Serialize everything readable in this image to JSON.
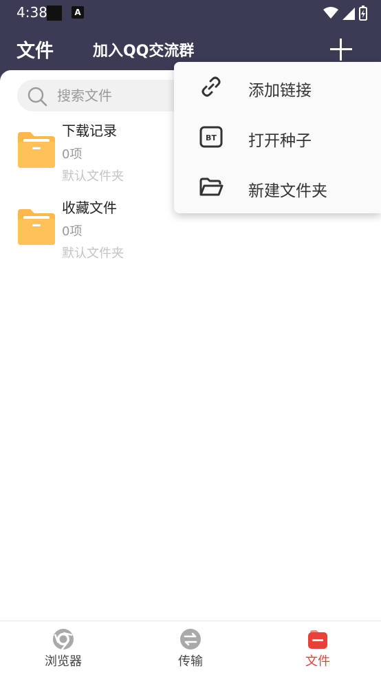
{
  "status": {
    "time": "4:38",
    "notif_letter": "A"
  },
  "header": {
    "title": "文件",
    "join_group": "加入QQ交流群"
  },
  "search": {
    "placeholder": "搜索文件"
  },
  "folders": [
    {
      "name": "下载记录",
      "count": "0项",
      "desc": "默认文件夹"
    },
    {
      "name": "收藏文件",
      "count": "0项",
      "desc": "默认文件夹"
    }
  ],
  "menu": {
    "items": [
      {
        "label": "添加链接",
        "icon": "link-icon"
      },
      {
        "label": "打开种子",
        "icon": "bt-icon"
      },
      {
        "label": "新建文件夹",
        "icon": "folder-open-icon"
      }
    ],
    "bt_text": "BT"
  },
  "nav": {
    "items": [
      {
        "label": "浏览器",
        "icon": "browser-icon"
      },
      {
        "label": "传输",
        "icon": "transfer-icon"
      },
      {
        "label": "文件",
        "icon": "files-icon"
      }
    ]
  },
  "colors": {
    "header_bg": "#3b3c54",
    "folder": "#ffb74a",
    "accent": "#e9403a"
  }
}
